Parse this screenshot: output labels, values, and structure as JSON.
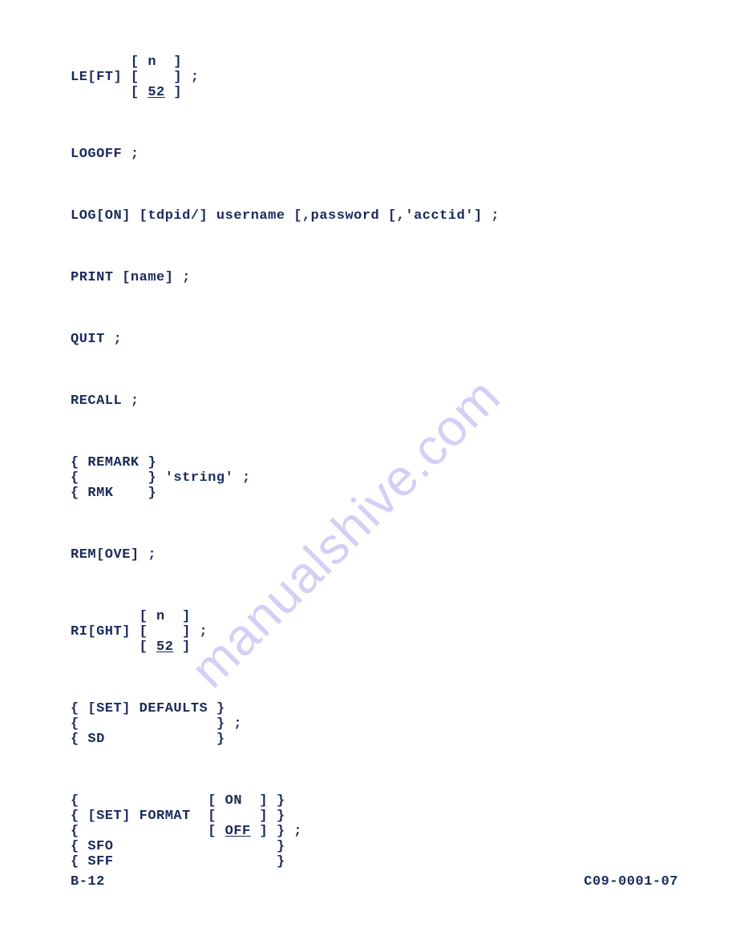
{
  "watermark": "manualshive.com",
  "footer": {
    "left": "B-12",
    "right": "C09-0001-07"
  },
  "syntax": {
    "left": {
      "l1": "       [ n  ]",
      "l2a": "LE[FT] [    ] ;",
      "l3a": "       [ ",
      "l3u": "52",
      "l3b": " ]"
    },
    "logoff": "LOGOFF ;",
    "logon": "LOG[ON] [tdpid/] username [,password [,'acctid'] ;",
    "print": "PRINT [name] ;",
    "quit": "QUIT ;",
    "recall": "RECALL ;",
    "remark": {
      "l1": "{ REMARK }",
      "l2": "{        } 'string' ;",
      "l3": "{ RMK    }"
    },
    "remove": "REM[OVE] ;",
    "right": {
      "l1": "        [ n  ]",
      "l2": "RI[GHT] [    ] ;",
      "l3a": "        [ ",
      "l3u": "52",
      "l3b": " ]"
    },
    "setdef": {
      "l1": "{ [SET] DEFAULTS }",
      "l2": "{                } ;",
      "l3": "{ SD             }"
    },
    "setfmt": {
      "l1": "{               [ ON  ] }",
      "l2": "{ [SET] FORMAT  [     ] }",
      "l3a": "{               [ ",
      "l3u": "OFF",
      "l3b": " ] } ;",
      "l4": "{ SFO                   }",
      "l5": "{ SFF                   }"
    }
  }
}
